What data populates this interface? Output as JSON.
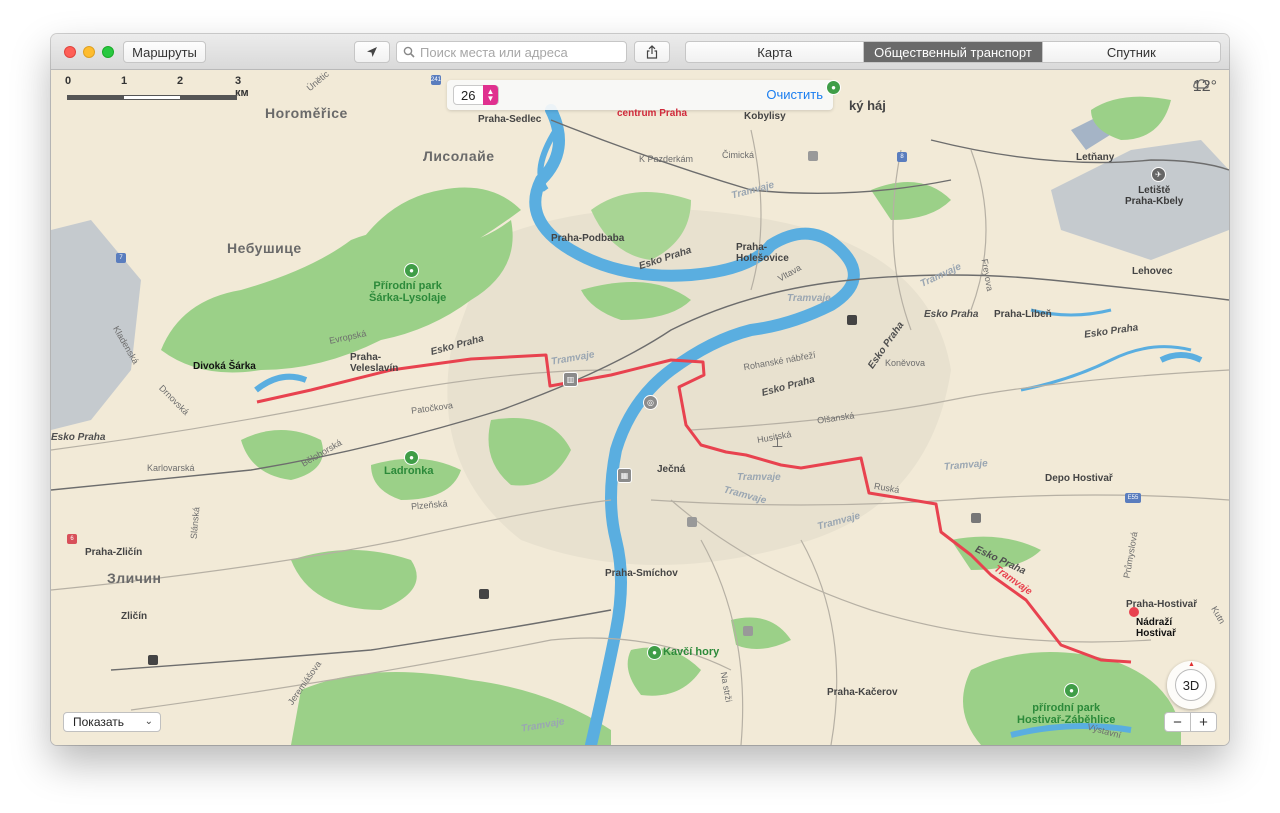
{
  "toolbar": {
    "routes_label": "Маршруты",
    "search_placeholder": "Поиск места или адреса",
    "modes": [
      "Карта",
      "Общественный транспорт",
      "Спутник"
    ],
    "active_mode": "Общественный транспорт"
  },
  "scale": {
    "ticks": [
      "0",
      "1",
      "2",
      "3 км"
    ]
  },
  "line_filter": {
    "value": "26",
    "clear_label": "Очистить"
  },
  "weather": {
    "temperature": "12°",
    "icon": "cloud-icon"
  },
  "controls": {
    "show_label": "Показать",
    "compass_label": "3D",
    "zoom_out": "−",
    "zoom_in": "+"
  },
  "colors": {
    "route": "#e8424f",
    "river": "#5aaee0",
    "park": "#8fcc7e",
    "land": "#f2ead7",
    "urban": "#e7e0cf"
  },
  "labels": {
    "horomerice": "Horoměřice",
    "lisolaje": "Лисолайе",
    "nebusice": "Небушице",
    "zlicin_ru": "Зличин",
    "praha_sedlec": "Praha-Sedlec",
    "centrum": "centrum Praha",
    "kobylisy": "Kobylisy",
    "cimicka": "Čimická",
    "k_pazderkam": "K Pazderkám",
    "letnany": "Letňany",
    "letiste": "Letiště\nPraha-Kbely",
    "praha_podbaba": "Praha-Podbaba",
    "praha_holesovice": "Praha-\nHolešovice",
    "sarka_park": "Přírodní park\nŠárka-Lysolaje",
    "evropska": "Evropská",
    "veleslavin": "Praha-\nVeleslavín",
    "divoka_sarka": "Divoká Šárka",
    "drnovska": "Drnovská",
    "kladenska": "Kladenská",
    "ladronka": "Ladronka",
    "belohorska": "Bělohorská",
    "patockova": "Patočkova",
    "karlovarska": "Karlovarská",
    "plzenska": "Plzeňská",
    "slanska": "Slánská",
    "praha_zlicin": "Praha-Zličín",
    "zlicin": "Zličín",
    "jeremiasova": "Jeremiášova",
    "jecna": "Ječná",
    "praha_smichov": "Praha-Smíchov",
    "kavci_hory": "Kavčí hory",
    "praha_kacerov": "Praha-Kačerov",
    "na_strzi": "Na strži",
    "vystavni": "Výstavní",
    "hostivar_park": "přírodní park\nHostivař-Záběhlice",
    "praha_hostivar": "Praha-Hostivař",
    "nadrazi_hostivar": "Nádraží\nHostivař",
    "prumyslova": "Průmyslová",
    "depo_hostivar": "Depo Hostivař",
    "ruska": "Ruská",
    "olsanska": "Olšanská",
    "husitska": "Husitská",
    "konevova": "Koněvova",
    "frydova": "Freyova",
    "praha_liben": "Praha-Libeň",
    "lehovec": "Lehovec",
    "rohanske": "Rohanské nábřeží",
    "vltava": "Vltava",
    "trojsky_haj": "ký háj",
    "kutnohorska": "Kutn",
    "unetice": "Únětic"
  },
  "road_labels": [
    "Esko Praha",
    "Esko Praha",
    "Esko Praha",
    "Esko Praha",
    "Esko Praha",
    "Esko Praha",
    "Esko Praha",
    "Esko Praha"
  ],
  "tram_label": "Tramvaje",
  "highway_shields": [
    "241",
    "7",
    "8",
    "E55",
    "6"
  ]
}
